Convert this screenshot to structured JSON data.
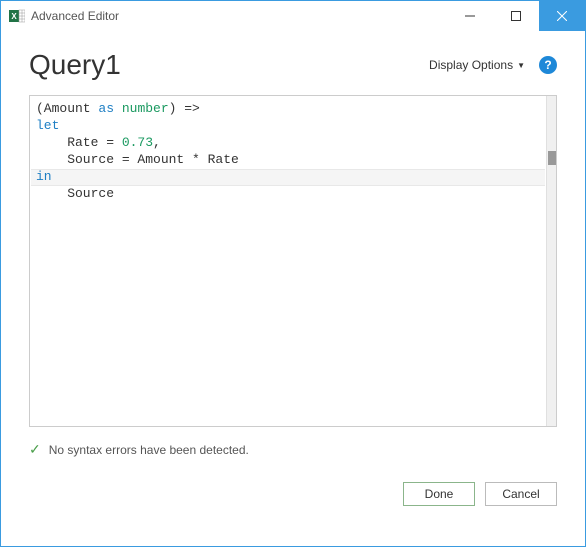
{
  "window": {
    "title": "Advanced Editor"
  },
  "header": {
    "query_name": "Query1",
    "display_options_label": "Display Options"
  },
  "editor": {
    "code_tokens": [
      [
        {
          "t": "(Amount "
        },
        {
          "t": "as",
          "c": "kw"
        },
        {
          "t": " "
        },
        {
          "t": "number",
          "c": "type"
        },
        {
          "t": ") =>"
        }
      ],
      [
        {
          "t": "let",
          "c": "kw"
        }
      ],
      [
        {
          "t": "    Rate = "
        },
        {
          "t": "0.73",
          "c": "num"
        },
        {
          "t": ","
        }
      ],
      [
        {
          "t": "    Source = Amount * Rate"
        }
      ],
      [
        {
          "t": "in",
          "c": "kw"
        }
      ],
      [
        {
          "t": "    Source"
        }
      ]
    ]
  },
  "status": {
    "message": "No syntax errors have been detected."
  },
  "footer": {
    "done_label": "Done",
    "cancel_label": "Cancel"
  }
}
